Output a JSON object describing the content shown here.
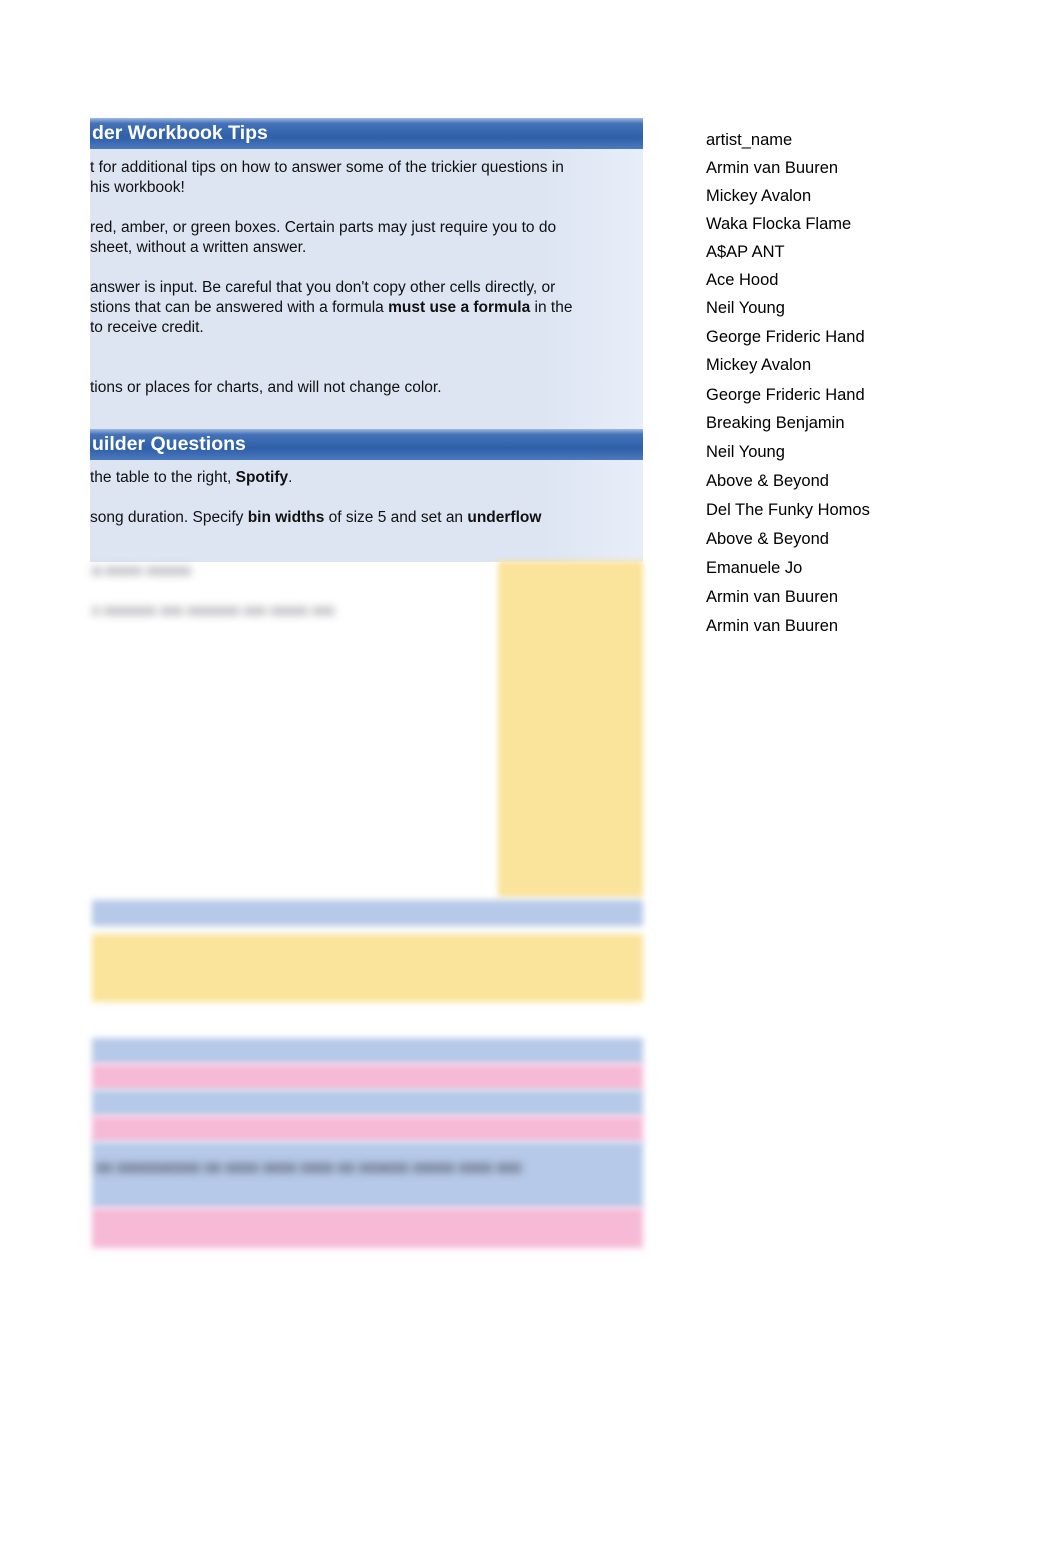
{
  "tips_panel": {
    "header": "der Workbook Tips",
    "lines": [
      "t for additional tips on how to answer some of the trickier questions in",
      " his workbook!",
      "",
      " red, amber, or green boxes. Certain parts may just require you to do",
      "sheet, without a written answer.",
      "",
      " answer is input. Be careful that you don't copy other cells directly, or",
      "stions that can be answered with a formula ",
      "must use a formula",
      " in the",
      " to receive credit.",
      "",
      "tions or places for charts, and will not change color."
    ],
    "line_a1": "t for additional tips on how to answer some of the trickier questions in",
    "line_a2": " his workbook!",
    "line_b1": " red, amber, or green boxes. Certain parts may just require you to do",
    "line_b2": "sheet, without a written answer.",
    "line_c1": " answer is input. Be careful that you don't copy other cells directly, or",
    "line_c2_pre": "stions that can be answered with a formula ",
    "line_c2_bold": "must use a formula",
    "line_c2_post": " in the",
    "line_c3": " to receive credit.",
    "line_d1": "tions or places for charts, and will not change color."
  },
  "questions_panel": {
    "header": "uilder Questions",
    "q1_pre": "the table to the right, ",
    "q1_bold": "Spotify",
    "q1_post": ".",
    "q2_pre": "song duration. Specify ",
    "q2_bold1": "bin widths",
    "q2_mid": " of size 5 and set an ",
    "q2_bold2": "underflow"
  },
  "redacted": {
    "line1": "a  xxxxx xxxxxx",
    "line2": "x  xxxxxxx xxx xxxxxxx xxx xxxxx xxx",
    "band_line_pre": "xx xxxxxxxxxx xx xxxx xxxx xxxx xx xxxxxx ",
    "band_line_bold": "xxxxx xxxx xxx"
  },
  "artist_column": {
    "header": "artist_name",
    "values": [
      "Armin van Buuren",
      "Mickey Avalon",
      "Waka Flocka Flame",
      "A$AP ANT",
      "Ace Hood",
      "Neil Young",
      "George Frideric Hand",
      "Mickey Avalon",
      "George Frideric Hand",
      "Breaking Benjamin",
      "Neil Young",
      "Above & Beyond",
      "Del The Funky Homos",
      "Above & Beyond",
      "Emanuele Jo",
      "Armin van Buuren",
      "Armin van Buuren"
    ]
  },
  "colors": {
    "header_blue": "#2e5fa8",
    "panel_body": "#dde5f3",
    "band_blue": "#b6c9e8",
    "band_yellow": "#fae39a",
    "band_pink": "#f6b9d6",
    "text": "#000000"
  }
}
